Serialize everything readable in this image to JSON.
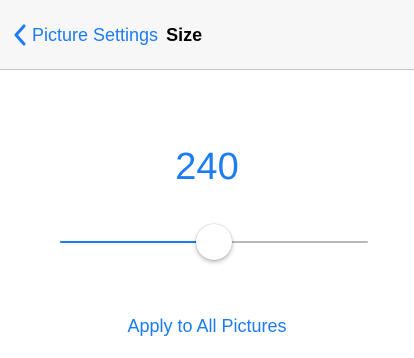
{
  "colors": {
    "accent": "#1c7cf2",
    "nav_background": "#f7f7f8",
    "track_inactive": "#b8b8b8"
  },
  "nav_bar": {
    "back_label": "Picture Settings",
    "back_icon": "chevron-left-icon",
    "title": "Size"
  },
  "size_setting": {
    "value": "240",
    "slider_fraction": 0.5
  },
  "actions": {
    "apply_all_label": "Apply to All Pictures"
  }
}
